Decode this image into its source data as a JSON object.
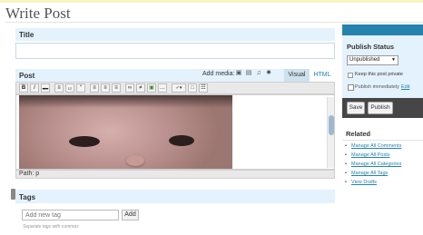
{
  "page": {
    "title": "Write Post"
  },
  "title_box": {
    "heading": "Title",
    "value": ""
  },
  "post_box": {
    "heading": "Post",
    "add_media_label": "Add media:",
    "media_icons": [
      "image-icon",
      "video-icon",
      "audio-icon",
      "media-icon"
    ],
    "tabs": {
      "visual": "Visual",
      "html": "HTML",
      "active": "Visual"
    },
    "toolbar": [
      {
        "icon": "bold-icon",
        "glyph": "B"
      },
      {
        "icon": "italic-icon",
        "glyph": "I"
      },
      {
        "icon": "strikethrough-icon",
        "glyph": "abc"
      },
      {
        "icon": "bulleted-list-icon",
        "glyph": "≡"
      },
      {
        "icon": "numbered-list-icon",
        "glyph": "1≡"
      },
      {
        "icon": "blockquote-icon",
        "glyph": "“"
      },
      {
        "icon": "align-left-icon",
        "glyph": "≡"
      },
      {
        "icon": "align-center-icon",
        "glyph": "≡"
      },
      {
        "icon": "align-right-icon",
        "glyph": "≡"
      },
      {
        "icon": "link-icon",
        "glyph": "∞"
      },
      {
        "icon": "unlink-icon",
        "glyph": "≠"
      },
      {
        "icon": "insert-image-icon",
        "glyph": "▣"
      },
      {
        "icon": "more-tag-icon",
        "glyph": "…"
      },
      {
        "icon": "spellcheck-icon",
        "glyph": "✓▾"
      },
      {
        "icon": "fullscreen-icon",
        "glyph": "□"
      },
      {
        "icon": "kitchen-sink-icon",
        "glyph": "☷"
      }
    ],
    "path": "Path: p"
  },
  "tags_box": {
    "heading": "Tags",
    "placeholder": "Add new tag",
    "add_label": "Add",
    "hint": "Separate tags with commas"
  },
  "publish_box": {
    "heading": "Publish Status",
    "status_value": "Unpublished",
    "private_label": "Keep this post private",
    "when_label": "Publish immediately",
    "edit_label": "Edit",
    "save_label": "Save",
    "publish_label": "Publish"
  },
  "related": {
    "heading": "Related",
    "links": [
      "Manage All Comments",
      "Manage All Posts",
      "Manage All Categories",
      "Manage All Tags",
      "View Drafts"
    ]
  },
  "colors": {
    "accent": "#2683ae",
    "box_header": "#e4f2fd",
    "action_bar": "#464646",
    "link": "#2583ad"
  }
}
